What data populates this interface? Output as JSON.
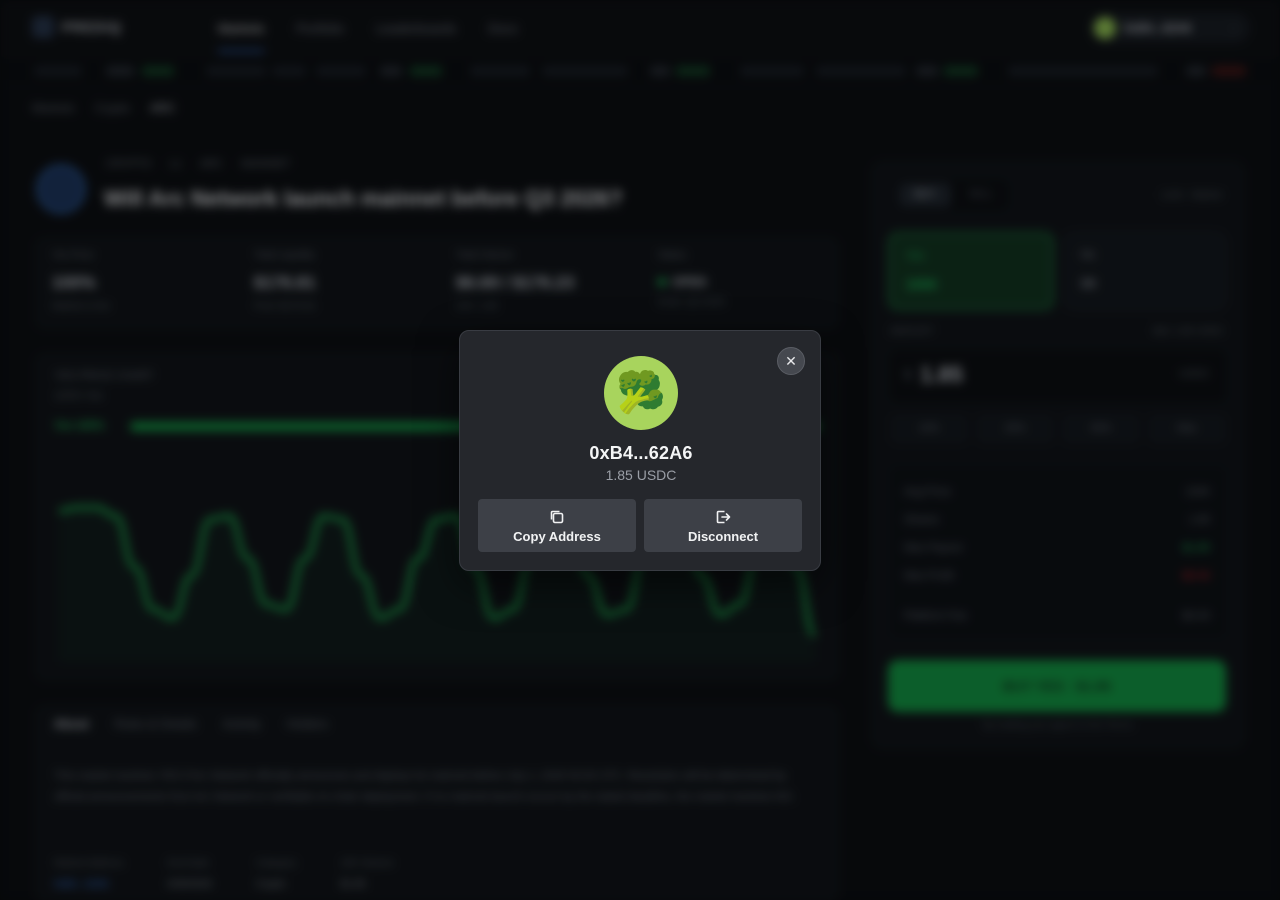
{
  "wallet_modal": {
    "address": "0xB4...62A6",
    "balance": "1.85 USDC",
    "copy_label": "Copy Address",
    "disconnect_label": "Disconnect",
    "avatar_emoji": "🥦",
    "avatar_color": "#a8d45d",
    "close_icon": "close-icon"
  },
  "app": {
    "logo": "PREDIQ",
    "nav": [
      "Markets",
      "Portfolio",
      "Leaderboards",
      "Docs"
    ],
    "account_name": "0xB4...62A6",
    "breadcrumbs": [
      "Markets",
      "Crypto",
      "ARC"
    ],
    "market_meta": [
      "CRYPTO",
      "L1",
      "ARC",
      "MAINNET"
    ],
    "market_title": "Will Arc Network launch mainnet before Q3 2026?",
    "stats": [
      {
        "label": "Yes Price",
        "value": "100%",
        "sub": "Market is live"
      },
      {
        "label": "Total Liquidity",
        "value": "$176.81",
        "sub": "Pool: $176.81"
      },
      {
        "label": "Total Volume",
        "value": "$6.69 / $176.23",
        "sub": "24h: 1.85"
      },
      {
        "label": "Status",
        "value": "OPEN",
        "sub": "Ends: Q3 2026"
      }
    ],
    "chart_header": "YES PRICE CHART",
    "chart_sub": "100% Yes",
    "prob_label": "Yes 100%",
    "prob_fraction": 1.0,
    "tabs": [
      "About",
      "Rules & Details",
      "Activity",
      "Holders"
    ],
    "description": "This market resolves YES if Arc Network officially announces and deploys its mainnet before July 1, 2026 00:00 UTC. Resolution will be determined by official announcements from Arc Network or verifiable on-chain deployment. If no mainnet launch occurs by the stated deadline, the market resolves NO.",
    "bottom_meta": [
      {
        "label": "Market Address",
        "value": "0xB4...62A6"
      },
      {
        "label": "End Date",
        "value": "6/30/2026"
      },
      {
        "label": "Category",
        "value": "Crypto"
      },
      {
        "label": "24h Volume",
        "value": "$1.85"
      }
    ],
    "trade": {
      "buy_tab": "BUY",
      "sell_tab": "SELL",
      "order_type": "Limit · Market",
      "outcome_yes": "Yes",
      "outcome_yes_price": "100¢",
      "outcome_no": "No",
      "outcome_no_price": "0¢",
      "amount_label": "AMOUNT",
      "balance_label": "Bal: 1.85 USDC",
      "amount_value": "1.85",
      "amount_unit": "USDC",
      "quick": [
        "10%",
        "25%",
        "50%",
        "Max"
      ],
      "summary": [
        {
          "label": "Avg Price",
          "value": "100¢"
        },
        {
          "label": "Shares",
          "value": "1.85"
        },
        {
          "label": "Max Payout",
          "value": "$1.85"
        },
        {
          "label": "Max Profit",
          "value": "$0.00"
        },
        {
          "label": "Platform Fee",
          "value": "$0.00"
        }
      ],
      "buy_button": "BUY YES · $1.85",
      "disclaimer": "By trading you agree to the Terms"
    }
  },
  "chart_data": {
    "type": "line",
    "title": "",
    "x": [
      0,
      1,
      2,
      3,
      4,
      5,
      6,
      7,
      8,
      9,
      10,
      11,
      12,
      13,
      14,
      15,
      16,
      17,
      18,
      19,
      20,
      21,
      22,
      23,
      24,
      25,
      26,
      27,
      28,
      29,
      30,
      31,
      32,
      33,
      34,
      35,
      36,
      37,
      38,
      39,
      40
    ],
    "series": [
      {
        "values": [
          0.83,
          0.85,
          0.85,
          0.8,
          0.5,
          0.25,
          0.2,
          0.45,
          0.78,
          0.8,
          0.55,
          0.28,
          0.25,
          0.55,
          0.8,
          0.78,
          0.45,
          0.2,
          0.25,
          0.55,
          0.78,
          0.8,
          0.5,
          0.2,
          0.25,
          0.55,
          0.8,
          0.78,
          0.45,
          0.22,
          0.25,
          0.58,
          0.82,
          0.78,
          0.45,
          0.22,
          0.28,
          0.6,
          0.8,
          0.5,
          0.1
        ]
      }
    ],
    "ylim": [
      0,
      1
    ],
    "color": "#1fa34e"
  }
}
